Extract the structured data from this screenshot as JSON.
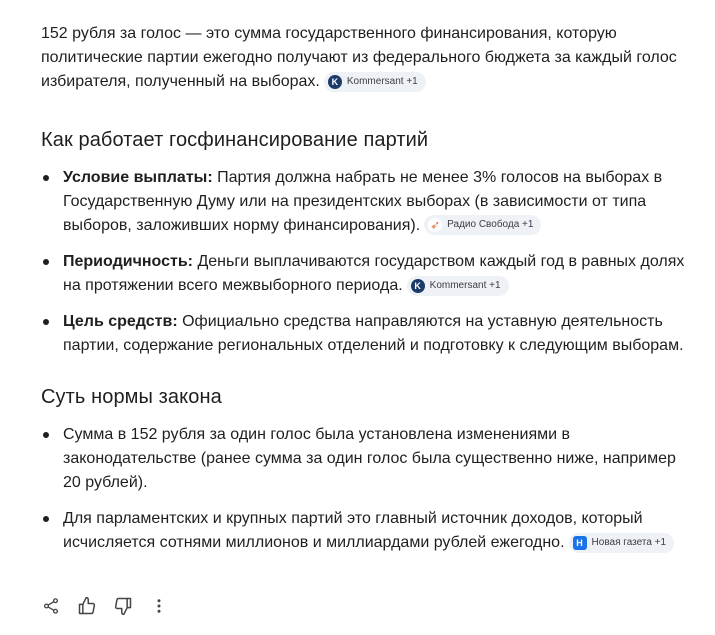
{
  "intro": {
    "text": "152 рубля за голос — это сумма государственного финансирования, которую политические партии ежегодно получают из федерального бюджета за каждый голос избирателя, полученный на выборах.",
    "source": "Kommersant +1"
  },
  "section1": {
    "heading": "Как работает госфинансирование партий",
    "items": [
      {
        "label": "Условие выплаты:",
        "text": "Партия должна набрать не менее 3% голосов на выборах в Государственную Думу или на президентских выборах (в зависимости от типа выборов, заложивших норму финансирования).",
        "source": "Радио Свобода +1",
        "source_icon": "radio-svoboda-icon"
      },
      {
        "label": "Периодичность:",
        "text": "Деньги выплачиваются государством каждый год в равных долях на протяжении всего межвыборного периода.",
        "source": "Kommersant +1",
        "source_icon": "kommersant-icon"
      },
      {
        "label": "Цель средств:",
        "text": "Официально средства направляются на уставную деятельность партии, содержание региональных отделений и подготовку к следующим выборам.",
        "source": "",
        "source_icon": ""
      }
    ]
  },
  "section2": {
    "heading": "Суть нормы закона",
    "items": [
      {
        "text": "Сумма в 152 рубля за один голос была установлена изменениями в законодательстве (ранее сумма за один голос была существенно ниже, например 20 рублей).",
        "source": ""
      },
      {
        "text": "Для парламентских и крупных партий это главный источник доходов, который исчисляется сотнями миллионов и миллиардами рублей ежегодно.",
        "source": "Новая газета +1",
        "source_icon": "novaya-gazeta-icon"
      }
    ]
  },
  "actions": [
    "share-icon",
    "thumbs-up-icon",
    "thumbs-down-icon",
    "more-vert-icon"
  ],
  "colors": {
    "text": "#1f1f1f",
    "chip_bg": "#eef1f5",
    "kommersant": "#1a3a6b",
    "radio": "#e8703a",
    "novaya": "#1a73e8"
  }
}
